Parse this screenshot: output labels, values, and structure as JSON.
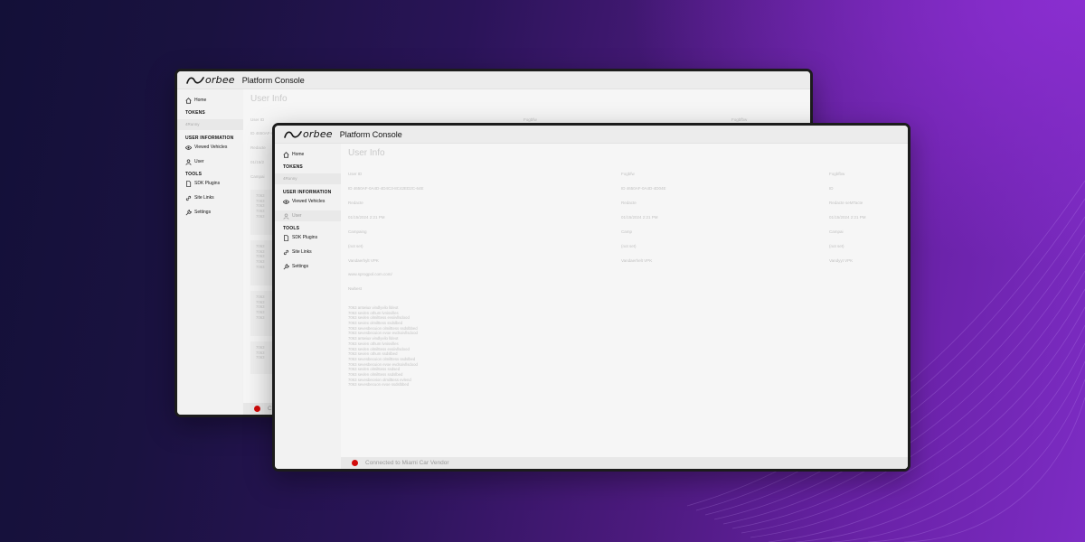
{
  "brand": {
    "logo_text": "orbee",
    "app_title": "Platform Console"
  },
  "colors": {
    "status_dot": "#d10a0a",
    "background_start": "#131038",
    "background_end": "#7d2cc4"
  },
  "sidebar": {
    "home": "Home",
    "tokens_heading": "TOKENS",
    "token_item": "4Runny",
    "user_info_heading": "USER INFORMATION",
    "viewed_vehicles": "Viewed Vehicles",
    "user": "User",
    "tools_heading": "TOOLS",
    "sdk_plugins": "SDK Plugins",
    "site_links": "Site Links",
    "settings": "Settings"
  },
  "back_window": {
    "title": "User Info",
    "header": {
      "col1": "User ID",
      "col2": "Fogbfw",
      "col3": "Fogbfbw"
    },
    "rows": [
      "ID 4650AF-0A4D",
      "Redacte",
      "01/15/2",
      "Campai"
    ],
    "cards": [
      [
        "7063",
        "7063",
        "7063",
        "7063",
        "7063"
      ],
      [
        "7063",
        "7063",
        "7063",
        "7063",
        "7063"
      ],
      [
        "7063",
        "7063",
        "7063",
        "7063",
        "7063"
      ],
      [
        "7063",
        "7063",
        "7063"
      ]
    ],
    "status_text": "C"
  },
  "main": {
    "title": "User Info",
    "rows": [
      {
        "c1": "User ID",
        "c2": "Fogbfw",
        "c3": "Fogbfbw"
      },
      {
        "c1": "ID 4650AF-0A4D-4D4C3-8C42ED2C-64E",
        "c2": "ID 4650AF-0A4D-4D04E",
        "c3": "ID"
      },
      {
        "c1": "Redacte",
        "c2": "Redacte",
        "c3": "Redacte seMTacte"
      },
      {
        "c1": "01/15/2024  2:21 PM",
        "c2": "01/15/2024  2:21 PM",
        "c3": "01/15/2024  2:21 PM"
      },
      {
        "c1": "Campaing",
        "c2": "Camp",
        "c3": "Campai"
      },
      {
        "c1": "(not set)",
        "c2": "(not set)",
        "c3": "(not set)"
      },
      {
        "c1": "Vandaerhylt VPK",
        "c2": "Vandaerhelt VPK",
        "c3": "Vandyyt VPK"
      }
    ],
    "url_line": "www.sprogpol.com.com/",
    "label_line": "Nwbest",
    "log": [
      "7063 antwiux vindlyvilo lldeot",
      "7063 sevlen othum lvnisvilles",
      "7063 sevlen olmilttess evsiivllsdood",
      "7063 seviex olmilttess ssdslbed",
      "7063 sevesbecuion olmilttess ssdslbbed",
      "7063 sevesbecuion evoe evdsoivllsdood",
      "7063 antwiux vindlyvilo lldeot",
      "7063 sevien othum lvnisvilles",
      "7063 sevlen olmilttess evsiivllsdood",
      "7063 sevien othum ssdslbed",
      "7063 sevesbecuion olmilttess ssdslbed",
      "7063 sevesbecuion evoe evdsoivllsdood",
      "7063 sevlen olmilttess ssdsed",
      "7063 sevlen olmilttess ssdslbed",
      "7063 sevesbecvion olmilttess evlend",
      "7063 sevesbecuon evoe ssdslbbed"
    ],
    "status_text": "Connected to Miami Car Vendor"
  }
}
